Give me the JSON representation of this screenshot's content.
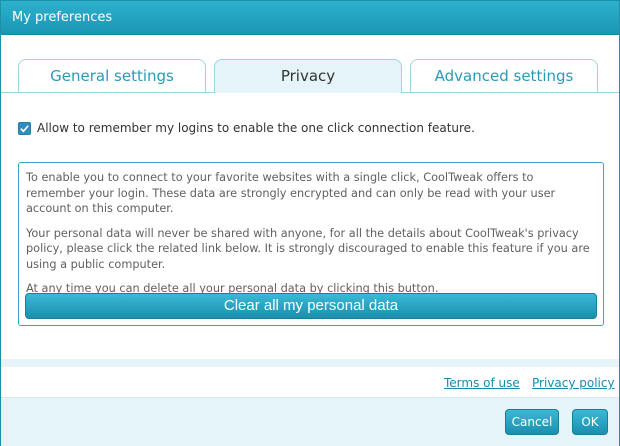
{
  "window": {
    "title": "My preferences"
  },
  "tabs": [
    {
      "label": "General settings",
      "active": false
    },
    {
      "label": "Privacy",
      "active": true
    },
    {
      "label": "Advanced settings",
      "active": false
    }
  ],
  "privacy": {
    "remember_logins": {
      "checked": true,
      "label": "Allow to remember my logins to enable the one click connection feature."
    },
    "info": {
      "paragraph1": "To enable you to connect to your favorite websites with a single click, CoolTweak offers to remember your login. These data are strongly encrypted and can only be read with your user account on this computer.",
      "paragraph2": "Your personal data will never be shared with anyone, for all the details about CoolTweak's privacy policy, please click the related link below. It is strongly discouraged to enable this feature if you are using a public computer.",
      "paragraph3": "At any time you can delete all your personal data by clicking this button."
    },
    "clear_button_label": "Clear all my personal data"
  },
  "links": {
    "terms": "Terms of use",
    "privacy_policy": "Privacy policy"
  },
  "footer": {
    "cancel_label": "Cancel",
    "ok_label": "OK"
  },
  "colors": {
    "accent": "#1a97b5",
    "panel": "#e4f4f8",
    "link": "#1b8ab0"
  },
  "icons": {
    "checkbox": "check-icon"
  }
}
